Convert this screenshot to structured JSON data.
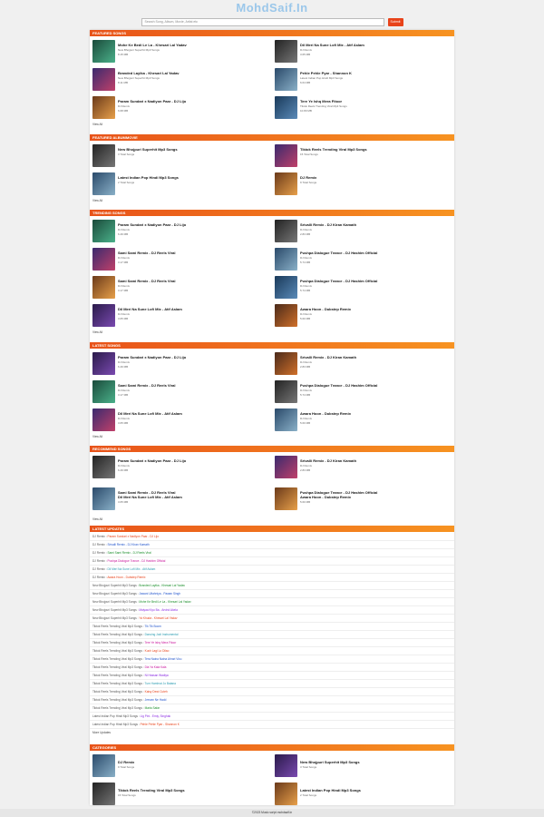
{
  "site_title": "MohdSaif.In",
  "search": {
    "placeholder": "Search Song, Album, Movie, Artist etc",
    "button": "Submit"
  },
  "featured_songs": {
    "heading": "FEATURED SONGS",
    "view_all": "View All",
    "items": [
      {
        "title": "Mohe Ke Bedi Le La - Khesari Lal Yadav",
        "subtitle": "New Bhojpuri Superhit Mp3 Songs",
        "size": "8.15 MB"
      },
      {
        "title": "Dil Meri Na Sune Lofi Mix - Atif Aslam",
        "subtitle": "DJ Remix",
        "size": "3.65 MB"
      },
      {
        "title": "Branded Layika - Khesari Lal Yadav",
        "subtitle": "New Bhojpuri Superhit Mp3 Songs",
        "size": "8.11 MB"
      },
      {
        "title": "Pehle Pehle Pyar - Shannon K",
        "subtitle": "Latest Indian Pop Hindi Mp3 Songs",
        "size": "6.64 MB"
      },
      {
        "title": "Param Sundari x Nadiyon Paar - DJ Lijo",
        "subtitle": "DJ Remix",
        "size": "6.68 MB"
      },
      {
        "title": "Tere Ye Ishq Mera Fitoor",
        "subtitle": "Tiktok Reels Trending Viral Mp3 Songs",
        "size": "10.80 MB"
      }
    ]
  },
  "featured_albums": {
    "heading": "FEATURED ALBUMMOVIE",
    "view_all": "View All",
    "items": [
      {
        "title": "New Bhojpuri Superhit Mp3 Songs",
        "subtitle": "3 Total Songs"
      },
      {
        "title": "Tiktok Reels Trending Viral Mp3 Songs",
        "subtitle": "15 Total Songs"
      },
      {
        "title": "Latest Indian Pop Hindi Mp3 Songs",
        "subtitle": "2 Total Songs"
      },
      {
        "title": "DJ Remix",
        "subtitle": "9 Total Songs"
      }
    ]
  },
  "trending_songs": {
    "heading": "TRENDING SONGS",
    "view_all": "View All",
    "items": [
      {
        "title": "Param Sundari x Nadiyon Paar - DJ Lijo",
        "subtitle": "DJ Remix",
        "size": "6.49 MB"
      },
      {
        "title": "Srivalli Remix - DJ Kiran Kamath",
        "subtitle": "DJ Remix",
        "size": "2.83 MB"
      },
      {
        "title": "Sami Sami Remix - DJ Reels Viral",
        "subtitle": "DJ Remix",
        "size": "3.17 MB"
      },
      {
        "title": "Pushpa Dialogue Trance - DJ Hashim Official",
        "subtitle": "DJ Remix",
        "size": "5.74 MB"
      },
      {
        "title": "Sami Sami Remix - DJ Reels Viral",
        "subtitle": "DJ Remix",
        "size": "3.17 MB"
      },
      {
        "title": "Pushpa Dialogue Trance - DJ Hashim Official",
        "subtitle": "DJ Remix",
        "size": "5.74 MB"
      },
      {
        "title": "Dil Meri Na Sune Lofi Mix - Atif Aslam",
        "subtitle": "DJ Remix",
        "size": "3.65 MB"
      },
      {
        "title": "Awara Hoon - Dubstep Remix",
        "subtitle": "DJ Remix",
        "size": "5.60 MB"
      }
    ]
  },
  "latest_songs": {
    "heading": "LATEST SONGS",
    "view_all": "View All",
    "items": [
      {
        "title": "Param Sundari x Nadiyon Paar - DJ Lijo",
        "subtitle": "DJ Remix",
        "size": "6.49 MB"
      },
      {
        "title": "Srivalli Remix - DJ Kiran Kamath",
        "subtitle": "DJ Remix",
        "size": "2.83 MB"
      },
      {
        "title": "Sami Sami Remix - DJ Reels Viral",
        "subtitle": "DJ Remix",
        "size": "3.17 MB"
      },
      {
        "title": "Pushpa Dialogue Trance - DJ Hashim Official",
        "subtitle": "DJ Remix",
        "size": "5.74 MB"
      },
      {
        "title": "Dil Meri Na Sune Lofi Mix - Atif Aslam",
        "subtitle": "DJ Remix",
        "size": "3.65 MB"
      },
      {
        "title": "Awara Hoon - Dubstep Remix",
        "subtitle": "DJ Remix",
        "size": "5.60 MB"
      }
    ]
  },
  "recommend_songs": {
    "heading": "RECOMMEND SONGS",
    "view_all": "View All",
    "items": [
      {
        "title": "Param Sundari x Nadiyon Paar - DJ Lijo",
        "subtitle": "DJ Remix",
        "size": "6.49 MB"
      },
      {
        "title": "Srivalli Remix - DJ Kiran Kamath",
        "subtitle": "DJ Remix",
        "size": "2.83 MB"
      },
      {
        "title": "Sami Sami Remix - DJ Reels Viral",
        "subtitle": "Dil Meri Na Sune Lofi Mix - Atif Aslam",
        "size": "3.65 MB",
        "title_bold_sub": true
      },
      {
        "title": "Pushpa Dialogue Trance - DJ Hashim Official",
        "subtitle": "Awara Hoon - Dubstep Remix",
        "size": "5.60 MB",
        "title_bold_sub": true
      }
    ]
  },
  "latest_updates": {
    "heading": "LATEST UPDATES",
    "more": "More Updates",
    "items": [
      {
        "prefix": "DJ Remix :",
        "text": "Param Sundari x Nadiyon Paar - DJ Lijo",
        "color": "#e8431a"
      },
      {
        "prefix": "DJ Remix :",
        "text": "Srivalli Remix - DJ Kiran Kamath",
        "color": "#2255cc"
      },
      {
        "prefix": "DJ Remix :",
        "text": "Sami Sami Remix - DJ Reels Viral",
        "color": "#1a8f2a"
      },
      {
        "prefix": "DJ Remix :",
        "text": "Pushpa Dialogue Trance - DJ Hashim Official",
        "color": "#c9139b"
      },
      {
        "prefix": "DJ Remix :",
        "text": "Dil Meri Na Sune Lofi Mix - Atif Aslam",
        "color": "#2a9bb0"
      },
      {
        "prefix": "DJ Remix :",
        "text": "Awara Hoon - Dubstep Remix",
        "color": "#e8431a"
      },
      {
        "prefix": "New Bhojpuri Superhit Mp3 Songs :",
        "text": "Branded Layika - Khesari Lal Yadav",
        "color": "#1a8f2a"
      },
      {
        "prefix": "New Bhojpuri Superhit Mp3 Songs :",
        "text": "Jawani Ultahniya - Pawan Singh",
        "color": "#2255cc"
      },
      {
        "prefix": "New Bhojpuri Superhit Mp3 Songs :",
        "text": "Mohe Ke Bedi Le La - Khesari Lal Yadav",
        "color": "#1a8f2a"
      },
      {
        "prefix": "New Bhojpuri Superhit Mp3 Songs :",
        "text": "Maiyaa Kiyo Ba - Arvind Akela",
        "color": "#8a2be2"
      },
      {
        "prefix": "New Bhojpuri Superhit Mp3 Songs :",
        "text": "Ya Khuda - Khesari Lal Yadav",
        "color": "#e8431a"
      },
      {
        "prefix": "Tiktok Reels Trending Viral Mp3 Songs :",
        "text": "Tik Tik Boom",
        "color": "#2255cc"
      },
      {
        "prefix": "Tiktok Reels Trending Viral Mp3 Songs :",
        "text": "Dancing Jodi Instrumental",
        "color": "#2a9bb0"
      },
      {
        "prefix": "Tiktok Reels Trending Viral Mp3 Songs :",
        "text": "Tere Ye Ishq Mera Fitoor",
        "color": "#c9139b"
      },
      {
        "prefix": "Tiktok Reels Trending Viral Mp3 Songs :",
        "text": "Kuch Lagi Lo Dilao",
        "color": "#e8431a"
      },
      {
        "prefix": "Tiktok Reels Trending Viral Mp3 Songs :",
        "text": "Tera Naina Naina Ahrari Vicu",
        "color": "#2255cc"
      },
      {
        "prefix": "Tiktok Reels Trending Viral Mp3 Songs :",
        "text": "Dia Ya Kala Kala",
        "color": "#c9139b"
      },
      {
        "prefix": "Tiktok Reels Trending Viral Mp3 Songs :",
        "text": "Ni Hassan Wadiya",
        "color": "#8a2be2"
      },
      {
        "prefix": "Tiktok Reels Trending Viral Mp3 Songs :",
        "text": "Tum Hamhrai Jo Batana",
        "color": "#2a9bb0"
      },
      {
        "prefix": "Tiktok Reels Trending Viral Mp3 Songs :",
        "text": "Kaisy Dewi Cuteh",
        "color": "#e8431a"
      },
      {
        "prefix": "Tiktok Reels Trending Viral Mp3 Songs :",
        "text": "Jeevan Ne Hadd",
        "color": "#2255cc"
      },
      {
        "prefix": "Tiktok Reels Trending Viral Mp3 Songs :",
        "text": "Maria Safar",
        "color": "#1a8f2a"
      },
      {
        "prefix": "Latest Indian Pop Hindi Mp3 Songs :",
        "text": "Lig Pini - Emiy, Singhak",
        "color": "#8a2be2"
      },
      {
        "prefix": "Latest Indian Pop Hindi Mp3 Songs :",
        "text": "Pehle Pehle Pyar - Shannon K",
        "color": "#e8431a"
      }
    ]
  },
  "categories": {
    "heading": "CATEGORIES",
    "items": [
      {
        "title": "DJ Remix",
        "subtitle": "9 Total Songs"
      },
      {
        "title": "New Bhojpuri Superhit Mp3 Songs",
        "subtitle": "3 Total Songs"
      },
      {
        "title": "Tiktok Reels Trending Viral Mp3 Songs",
        "subtitle": "15 Total Songs"
      },
      {
        "title": "Latest Indian Pop Hindi Mp3 Songs",
        "subtitle": "2 Total Songs"
      }
    ]
  },
  "footer": "©2023 Music script.mohdsaif.in",
  "colors": {
    "accent": "#e8531a",
    "accent2": "#f79321",
    "logo": "#9bc7ea"
  }
}
